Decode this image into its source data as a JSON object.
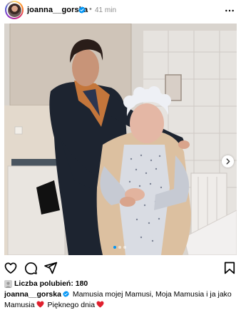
{
  "header": {
    "username": "joanna__gorska",
    "separator": "•",
    "time": "41 min",
    "avatar_icon": "profile-photo",
    "verified_icon": "verified-badge-icon",
    "more_icon": "more-horizontal-icon"
  },
  "media": {
    "carousel_total": 3,
    "carousel_active": 1,
    "next_icon": "chevron-right-icon"
  },
  "actions": {
    "like_icon": "heart-icon",
    "comment_icon": "comment-icon",
    "share_icon": "paper-plane-icon",
    "save_icon": "bookmark-icon"
  },
  "likes": {
    "label": "Liczba polubień: 180"
  },
  "caption": {
    "username": "joanna__gorska",
    "part1": "Mamusia mojej Mamusi, Moja Mamusia i ja jako Mamusia",
    "part2": "Pięknego dnia",
    "emoji_icon": "red-heart-icon"
  },
  "colors": {
    "verified": "#0095f6",
    "text_secondary": "#8e8e8e",
    "heart": "#e0202e",
    "active_dot": "#0095f6"
  }
}
